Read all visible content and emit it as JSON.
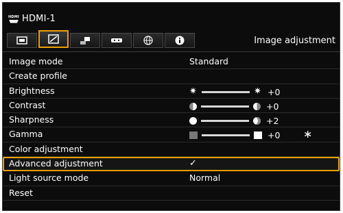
{
  "source": {
    "name": "HDMI-1",
    "badge_top": "HDMI",
    "icon": "hdmi-icon"
  },
  "tabs": [
    {
      "name": "display-tab",
      "icon": "monitor-icon"
    },
    {
      "name": "image-tab",
      "icon": "image-adjust-icon",
      "active": true
    },
    {
      "name": "install-tab",
      "icon": "projector-install-icon"
    },
    {
      "name": "system-tab",
      "icon": "remote-icon"
    },
    {
      "name": "network-tab",
      "icon": "globe-icon"
    },
    {
      "name": "info-tab",
      "icon": "info-icon"
    }
  ],
  "tab_title": "Image adjustment",
  "menu": {
    "image_mode": {
      "label": "Image mode",
      "value": "Standard"
    },
    "create_profile": {
      "label": "Create profile"
    },
    "brightness": {
      "label": "Brightness",
      "value": "+0",
      "level": 0.5
    },
    "contrast": {
      "label": "Contrast",
      "value": "+0",
      "level": 0.5
    },
    "sharpness": {
      "label": "Sharpness",
      "value": "+2",
      "level": 0.6
    },
    "gamma": {
      "label": "Gamma",
      "value": "+0",
      "level": 0.5,
      "mark": "∗"
    },
    "color_adjustment": {
      "label": "Color adjustment"
    },
    "advanced_adjustment": {
      "label": "Advanced adjustment",
      "value": "✓",
      "selected": true
    },
    "light_source_mode": {
      "label": "Light source mode",
      "value": "Normal"
    },
    "reset": {
      "label": "Reset"
    }
  },
  "colors": {
    "accent": "#f0a000",
    "background": "#0c0c0c",
    "text": "#ffffff"
  }
}
